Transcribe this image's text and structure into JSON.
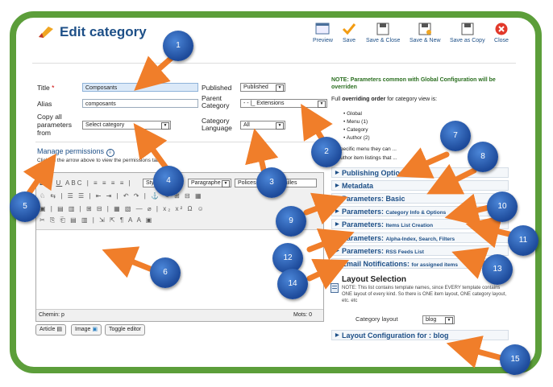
{
  "header": {
    "title": "Edit category"
  },
  "toolbar": {
    "preview": "Preview",
    "save": "Save",
    "save_close": "Save & Close",
    "save_new": "Save & New",
    "save_copy": "Save as Copy",
    "close": "Close"
  },
  "form": {
    "title_label": "Title",
    "required_mark": "*",
    "title_value": "Composants",
    "alias_label": "Alias",
    "alias_value": "composants",
    "copy_label": "Copy all parameters from",
    "copy_value": "Select category",
    "published_label": "Published",
    "published_value": "Published",
    "parent_label": "Parent Category",
    "parent_value": "- - |_ Extensions",
    "language_label": "Category Language",
    "language_value": "All"
  },
  "permissions": {
    "title": "Manage permissions",
    "hint": "Click on the arrow above to view the permissions table."
  },
  "editor": {
    "style_select": "Styles",
    "format_select": "Paragraphe",
    "font_select": "Polices",
    "size_select": "Tailles",
    "path": "Chemin: p",
    "words": "Mots: 0",
    "buttons": {
      "article": "Article",
      "image": "Image",
      "toggle": "Toggle editor"
    }
  },
  "params_note": {
    "heading": "NOTE: Parameters common with Global Configuration will be overriden",
    "order_prefix": "Full",
    "order_bold": "overriding order",
    "order_suffix": "for category view is:",
    "order_items": [
      "Global",
      "Menu (1)",
      "Category",
      "Author (2)"
    ],
    "frag1": "or specific menu they can ...",
    "frag2": "or author item listings that ..."
  },
  "accordion": [
    {
      "label": "Publishing Options",
      "sub": ""
    },
    {
      "label": "Metadata",
      "sub": ""
    },
    {
      "label": "Parameters: Basic",
      "sub": ""
    },
    {
      "label": "Parameters:",
      "sub": "Category Info & Options"
    },
    {
      "label": "Parameters:",
      "sub": "Items List Creation"
    },
    {
      "label": "Parameters:",
      "sub": "Alpha-Index, Search, Filters"
    },
    {
      "label": "Parameters:",
      "sub": "RSS Feeds List"
    },
    {
      "label": "Email Notifications:",
      "sub": "for assigned items"
    }
  ],
  "layout": {
    "title": "Layout Selection",
    "note": "NOTE: This list contains template names, since EVERY template contains ONE layout of every kind. So there is ONE item layout, ONE category layout, etc. etc",
    "category_layout_label": "Category layout",
    "category_layout_value": "blog",
    "config_label": "Layout Configuration for : blog"
  },
  "markers": [
    "1",
    "2",
    "3",
    "4",
    "5",
    "6",
    "7",
    "8",
    "9",
    "10",
    "11",
    "12",
    "13",
    "14",
    "15"
  ],
  "colors": {
    "frame": "#5c9e3a",
    "arrow": "#f07e2a",
    "marker": "#1d4a9a",
    "link": "#1d4f87"
  }
}
